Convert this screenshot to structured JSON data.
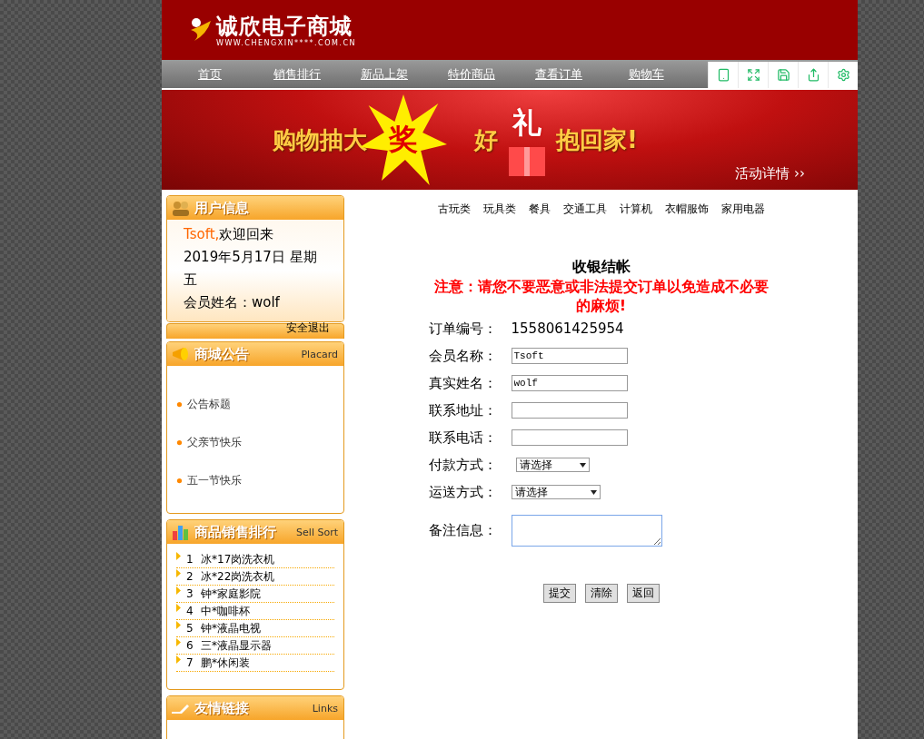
{
  "header": {
    "logo_title": "诚欣电子商城",
    "logo_url": "WWW.CHENGXIN****.COM.CN"
  },
  "nav": {
    "items": [
      "首页",
      "销售排行",
      "新品上架",
      "特价商品",
      "查看订单",
      "购物车"
    ]
  },
  "banner": {
    "part_1": "购物抽大",
    "star_word": "奖",
    "part_2": "好",
    "gift_word": "礼",
    "part_3": "抱回家!",
    "details_link": "活动详情 ››"
  },
  "user_box": {
    "title": "用户信息",
    "user": "Tsoft,",
    "welcome": "欢迎回来",
    "date": "2019年5月17日 星期五",
    "member": "会员姓名：wolf",
    "logout": "安全退出"
  },
  "notice_box": {
    "title": "商城公告",
    "subtitle": "Placard",
    "items": [
      "公告标题",
      "父亲节快乐",
      "五一节快乐"
    ]
  },
  "sales_box": {
    "title": "商品销售排行",
    "subtitle": "Sell Sort",
    "items": [
      {
        "rank": "1",
        "name": "冰*17岗洗衣机"
      },
      {
        "rank": "2",
        "name": "冰*22岗洗衣机"
      },
      {
        "rank": "3",
        "name": "钟*家庭影院"
      },
      {
        "rank": "4",
        "name": "中*咖啡杯"
      },
      {
        "rank": "5",
        "name": "钟*液晶电视"
      },
      {
        "rank": "6",
        "name": "三*液晶显示器"
      },
      {
        "rank": "7",
        "name": "鹏*休闲装"
      }
    ]
  },
  "links_box": {
    "title": "友情链接",
    "subtitle": "Links"
  },
  "categories": [
    "古玩类",
    "玩具类",
    "餐具",
    "交通工具",
    "计算机",
    "衣帽服饰",
    "家用电器"
  ],
  "checkout": {
    "title": "收银结帐",
    "warning": "注意：请您不要恶意或非法提交订单以免造成不必要的麻烦!",
    "fields": [
      {
        "kind": "static",
        "label": "订单编号：",
        "value": "1558061425954"
      },
      {
        "kind": "text",
        "label": "会员名称：",
        "value": "Tsoft"
      },
      {
        "kind": "text",
        "label": "真实姓名：",
        "value": "wolf"
      },
      {
        "kind": "text",
        "label": "联系地址："
      },
      {
        "kind": "text",
        "label": "联系电话："
      },
      {
        "kind": "select",
        "label": "付款方式：",
        "value": "请选择"
      },
      {
        "kind": "select",
        "label": "运送方式：",
        "value": "请选择"
      },
      {
        "kind": "textarea",
        "label": "备注信息："
      }
    ],
    "buttons": [
      "提交",
      "清除",
      "返回"
    ]
  }
}
